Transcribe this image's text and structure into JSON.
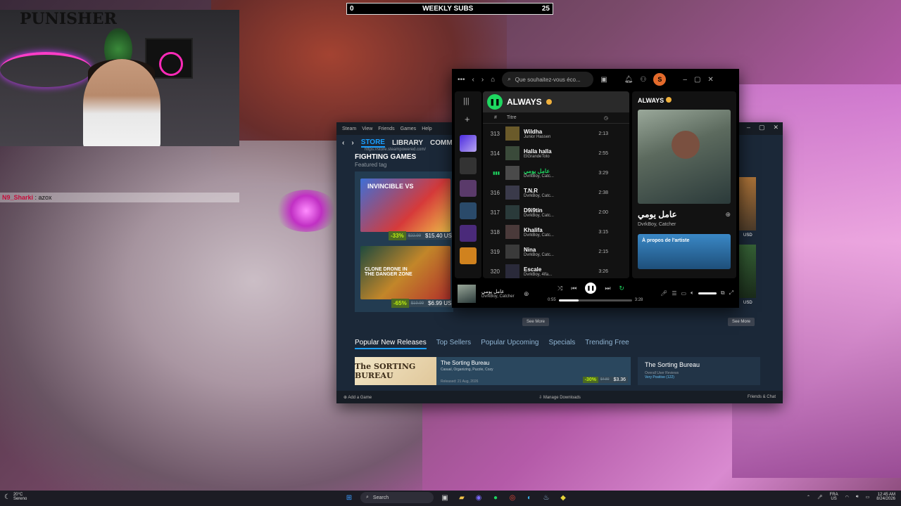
{
  "stream": {
    "subs_label": "WEEKLY SUBS",
    "subs_current": "0",
    "subs_goal": "25",
    "chat_user": "N9_Sharki",
    "chat_message": ": azox",
    "webcam_logo": "PUNISHER"
  },
  "steam": {
    "menu": [
      "Steam",
      "View",
      "Friends",
      "Games",
      "Help"
    ],
    "nav": {
      "store": "STORE",
      "library": "LIBRARY",
      "community": "COMMUNI"
    },
    "url": "https://store.steampowered.com/",
    "section_title": "FIGHTING GAMES",
    "section_sub": "Featured tag",
    "games": [
      {
        "name": "INVINCIBLE VS",
        "discount": "-33%",
        "orig": "$22.99",
        "final": "$15.40 USD"
      },
      {
        "name": "CLONE DRONE IN THE DANGER ZONE",
        "discount": "-65%",
        "orig": "$19.99",
        "final": "$6.99 USD"
      }
    ],
    "right_price_1": "USD",
    "right_price_2": "USD",
    "see_more_1": "See More",
    "see_more_2": "See More",
    "tabs": [
      "Popular New Releases",
      "Top Sellers",
      "Popular Upcoming",
      "Specials",
      "Trending Free"
    ],
    "release": {
      "thumb_text": "The SORTING BUREAU",
      "title": "The Sorting Bureau",
      "tags": "Casual, Organizing, Puzzle, Cozy",
      "date": "Released: 21 Aug, 2026",
      "discount": "-30%",
      "orig": "$4.80",
      "final": "$3.36"
    },
    "sidecard": {
      "title": "The Sorting Bureau",
      "reviews_label": "Overall User Reviews",
      "reviews_value": "Very Positive (122)"
    },
    "bottom": {
      "add_game": "Add a Game",
      "downloads": "Manage Downloads",
      "friends": "Friends & Chat"
    }
  },
  "spotify": {
    "search_placeholder": "Que souhaitez-vous éco...",
    "avatar_letter": "S",
    "playlist_title": "ALWAYS",
    "col_num": "#",
    "col_title": "Titre",
    "tracks": [
      {
        "num": "313",
        "title": "Wildha",
        "artist": "Junior Hassen",
        "dur": "2:13"
      },
      {
        "num": "314",
        "title": "Halla halla",
        "artist": "ElGrandeToto",
        "dur": "2:55"
      },
      {
        "num": "",
        "title": "عامل يومي",
        "artist": "DvrkBoy, Catc...",
        "dur": "3:29"
      },
      {
        "num": "316",
        "title": "T.N.R",
        "artist": "DvrkBoy, Catc...",
        "dur": "2:38"
      },
      {
        "num": "317",
        "title": "D9i9tin",
        "artist": "DvrkBoy, Catc...",
        "dur": "2:00"
      },
      {
        "num": "318",
        "title": "Khalifa",
        "artist": "DvrkBoy, Catc...",
        "dur": "3:15"
      },
      {
        "num": "319",
        "title": "Nina",
        "artist": "DvrkBoy, Catc...",
        "dur": "2:15"
      },
      {
        "num": "320",
        "title": "Escale",
        "artist": "DvrkBoy, 4lfa...",
        "dur": "3:26"
      }
    ],
    "now_panel_title": "ALWAYS",
    "now_song": "عامل يومي",
    "now_artist": "DvrkBoy, Catcher",
    "about_label": "À propos de l'artiste",
    "player": {
      "song": "عامل يومي",
      "artist": "DvrkBoy, Catcher",
      "elapsed": "0:55",
      "total": "3:28",
      "progress": 0.27
    }
  },
  "taskbar": {
    "temp": "20°C",
    "weather": "Sereno",
    "search": "Search",
    "lang_1": "FRA",
    "lang_2": "US",
    "time": "12:45 AM",
    "date": "8/24/2026"
  }
}
